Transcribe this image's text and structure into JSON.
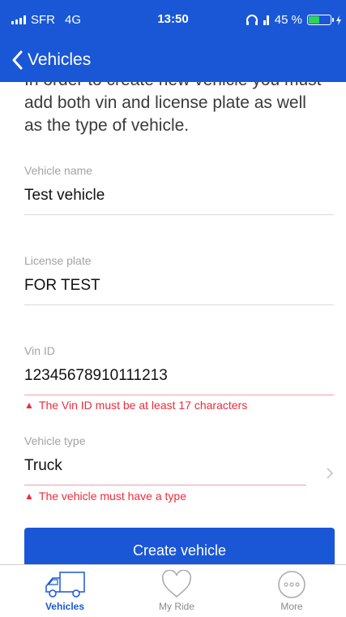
{
  "status_bar": {
    "carrier": "SFR",
    "network": "4G",
    "time": "13:50",
    "battery": "45 %",
    "battery_level": 0.45
  },
  "nav": {
    "back_label": "Vehicles"
  },
  "intro_text": "In order to create new vehicle you must add both vin and license plate as well as the type of vehicle.",
  "form": {
    "vehicle_name": {
      "label": "Vehicle name",
      "value": "Test vehicle"
    },
    "license_plate": {
      "label": "License plate",
      "value": "FOR TEST"
    },
    "vin_id": {
      "label": "Vin ID",
      "value": "12345678910111213",
      "error": "The Vin ID must be at least 17 characters"
    },
    "vehicle_type": {
      "label": "Vehicle type",
      "value": "Truck",
      "error": "The vehicle must have a type"
    },
    "submit_label": "Create vehicle"
  },
  "tabs": [
    {
      "label": "Vehicles",
      "icon": "truck-icon",
      "active": true
    },
    {
      "label": "My Ride",
      "icon": "heart-icon",
      "active": false
    },
    {
      "label": "More",
      "icon": "more-icon",
      "active": false
    }
  ],
  "colors": {
    "primary": "#1a57d6",
    "error": "#ef2b3b",
    "battery": "#2fd15a"
  }
}
